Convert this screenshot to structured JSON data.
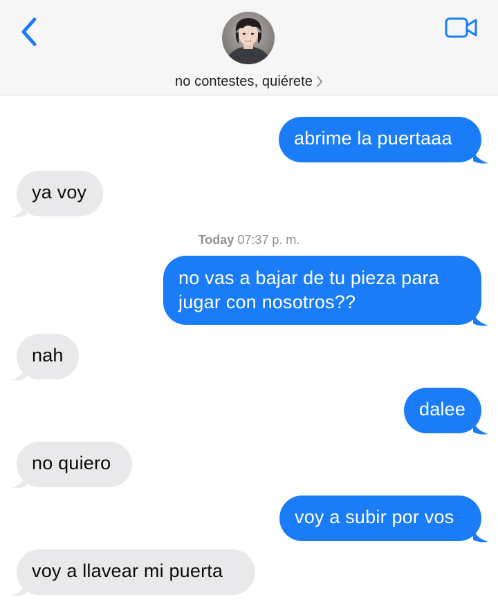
{
  "header": {
    "contact_name": "no contestes, quiérete",
    "back_icon": "chevron-left-icon",
    "video_icon": "video-camera-icon",
    "accent_color": "#1a7cf6"
  },
  "timestamp": {
    "day": "Today",
    "time": "07:37 p. m."
  },
  "messages": [
    {
      "direction": "out",
      "text": "abrime la puertaaa"
    },
    {
      "direction": "in",
      "text": "ya voy"
    },
    {
      "direction": "out",
      "lines": [
        "no vas a bajar de tu pieza para",
        "jugar con nosotros??"
      ]
    },
    {
      "direction": "in",
      "text": "nah"
    },
    {
      "direction": "out",
      "text": "dalee"
    },
    {
      "direction": "in",
      "text": "no quiero"
    },
    {
      "direction": "out",
      "text": "voy a subir por vos"
    },
    {
      "direction": "in",
      "text": "voy a llavear mi puerta"
    }
  ],
  "colors": {
    "outgoing_bubble": "#1a7cf6",
    "incoming_bubble": "#e9e9eb",
    "header_bg": "#f6f6f7"
  }
}
